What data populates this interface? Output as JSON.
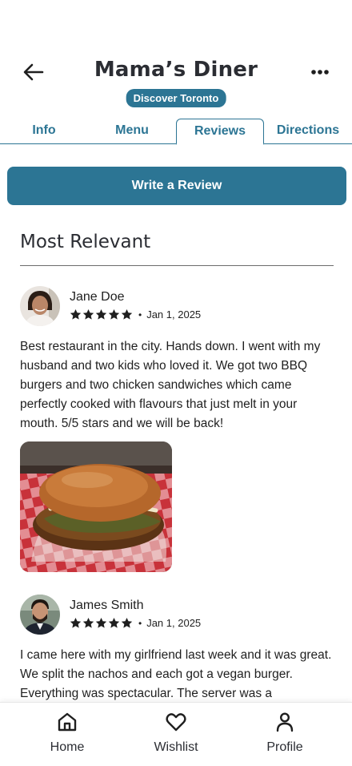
{
  "header": {
    "title": "Mama’s Diner",
    "badge": "Discover Toronto",
    "back_icon": "arrow-left-icon",
    "more_icon": "more-horizontal-icon"
  },
  "tabs": [
    {
      "label": "Info",
      "active": false
    },
    {
      "label": "Menu",
      "active": false
    },
    {
      "label": "Reviews",
      "active": true
    },
    {
      "label": "Directions",
      "active": false
    }
  ],
  "write_review_label": "Write a Review",
  "section": {
    "title": "Most Relevant"
  },
  "reviews": [
    {
      "name": "Jane Doe",
      "rating": 5,
      "separator": "•",
      "date": "Jan 1, 2025",
      "text": "Best restaurant in the city. Hands down. I went with my husband and two kids who loved it. We got two BBQ burgers and two chicken sandwiches which came perfectly cooked with flavours that just melt in your mouth. 5/5 stars and we will be back!",
      "has_photo": true
    },
    {
      "name": "James Smith",
      "rating": 5,
      "separator": "•",
      "date": "Jan 1, 2025",
      "text": "I came here with my girlfriend last week and it was great. We split the nachos and each got a vegan burger. Everything was spectacular. The server was a",
      "has_photo": false
    }
  ],
  "bottom_nav": [
    {
      "label": "Home",
      "icon": "home-icon"
    },
    {
      "label": "Wishlist",
      "icon": "heart-icon"
    },
    {
      "label": "Profile",
      "icon": "user-icon"
    }
  ],
  "colors": {
    "accent": "#2c7594",
    "text": "#1f1f1f",
    "title": "#2b2d33"
  }
}
